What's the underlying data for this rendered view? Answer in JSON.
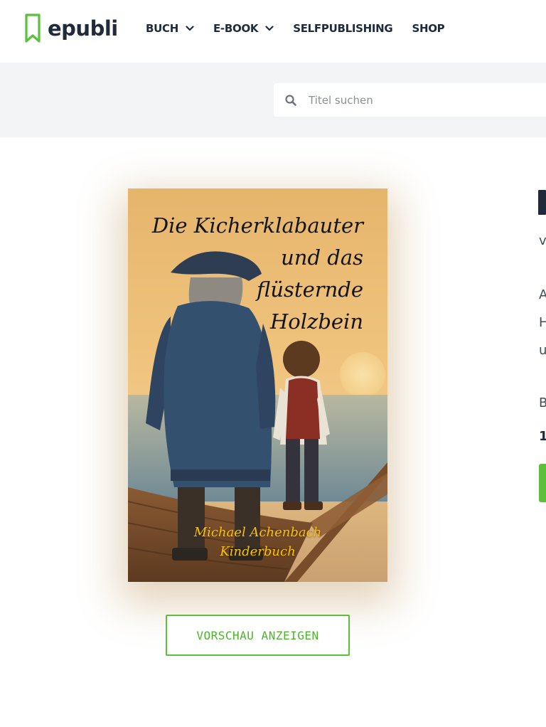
{
  "header": {
    "logo_text": "epubli",
    "nav": [
      {
        "label": "BUCH",
        "has_dropdown": true
      },
      {
        "label": "E-BOOK",
        "has_dropdown": true
      },
      {
        "label": "SELFPUBLISHING",
        "has_dropdown": false
      },
      {
        "label": "SHOP",
        "has_dropdown": false
      }
    ]
  },
  "search": {
    "placeholder": "Titel suchen",
    "value": ""
  },
  "book": {
    "cover": {
      "title_lines": [
        "Die Kicherklabauter",
        "und das",
        "flüsternde",
        "Holzbein"
      ],
      "author_lines": [
        "Michael Achenbach",
        "Kinderbuch"
      ]
    },
    "preview_button_label": "VORSCHAU ANZEIGEN"
  },
  "right_column_fragments": [
    "v",
    "A",
    "H",
    "u",
    "B",
    "1"
  ],
  "colors": {
    "brand_green": "#5cc03a",
    "text_dark": "#1f2b3a",
    "search_band_bg": "#f3f4f6"
  }
}
